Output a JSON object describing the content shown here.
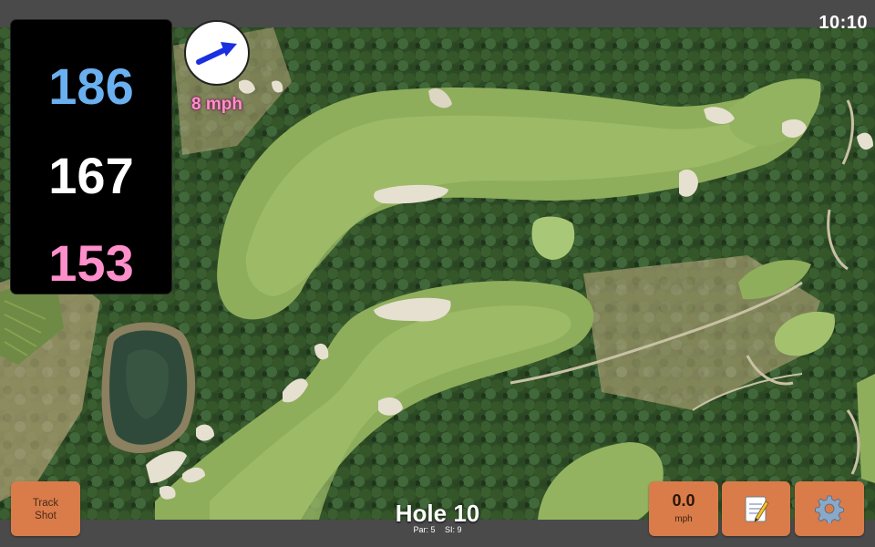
{
  "status": {
    "time": "10:10"
  },
  "distances": {
    "back": "186",
    "middle": "167",
    "front": "153"
  },
  "wind": {
    "speed_label": "8 mph"
  },
  "hole": {
    "title": "Hole 10",
    "par_label": "Par: 5",
    "si_label": "SI: 9"
  },
  "buttons": {
    "track_shot_line1": "Track",
    "track_shot_line2": "Shot",
    "wind_value": "0.0",
    "wind_unit": "mph"
  },
  "icons": {
    "wind_arrow": "wind-direction-arrow-icon",
    "notes": "notepad-icon",
    "settings": "gear-icon"
  },
  "colors": {
    "back_distance": "#6ab0f0",
    "middle_distance": "#ffffff",
    "front_distance": "#ff8fcb",
    "button_bg": "#d97c4a",
    "bar_bg": "#4a4a4a"
  }
}
